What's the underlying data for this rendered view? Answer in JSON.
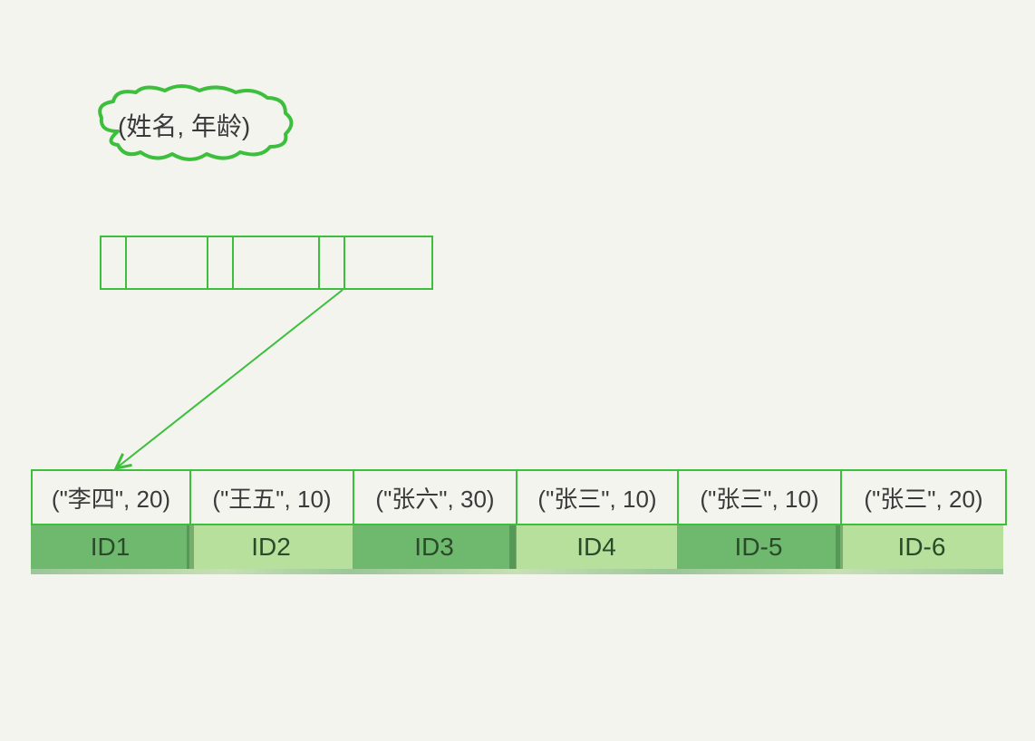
{
  "cloud_label": "(姓名, 年龄)",
  "tuples": [
    {
      "text": "(\"李四\", 20)",
      "id": "ID1"
    },
    {
      "text": "(\"王五\", 10)",
      "id": "ID2"
    },
    {
      "text": "(\"张六\", 30)",
      "id": "ID3"
    },
    {
      "text": "(\"张三\", 10)",
      "id": "ID4"
    },
    {
      "text": "(\"张三\", 10)",
      "id": "ID-5"
    },
    {
      "text": "(\"张三\", 20)",
      "id": "ID-6"
    }
  ],
  "chart_data": {
    "type": "table",
    "title": "(姓名, 年龄)",
    "columns": [
      "姓名",
      "年龄"
    ],
    "rows": [
      {
        "id": "ID1",
        "姓名": "李四",
        "年龄": 20
      },
      {
        "id": "ID2",
        "姓名": "王五",
        "年龄": 10
      },
      {
        "id": "ID3",
        "姓名": "张六",
        "年龄": 30
      },
      {
        "id": "ID4",
        "姓名": "张三",
        "年龄": 10
      },
      {
        "id": "ID-5",
        "姓名": "张三",
        "年龄": 10
      },
      {
        "id": "ID-6",
        "姓名": "张三",
        "年龄": 20
      }
    ]
  }
}
